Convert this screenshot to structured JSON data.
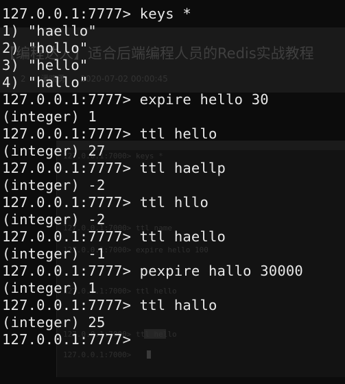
{
  "background_color": "#0c0c0c",
  "text_color": "#e8e8e8",
  "ghost": {
    "title": "【编程达人】适合后端编程人员的Redis实战教程",
    "meta": [
      "2",
      "潘晓勇",
      "2020-07-02 00:00:45"
    ],
    "lines": [
      "127.0.0.1:7000> keys *",
      "127.0.0.1:7000> ttl name",
      "127.0.0.1:7000> expire hello 100",
      "127.0.0.1:7000> ttl hello",
      "127.0.0.1:7000> ttl hello",
      "127.0.0.1:7000>"
    ]
  },
  "terminal": {
    "lines": [
      "127.0.0.1:7777> keys *",
      "1) \"haello\"",
      "2) \"hollo\"",
      "3) \"hello\"",
      "4) \"hallo\"",
      "127.0.0.1:7777> expire hello 30",
      "(integer) 1",
      "127.0.0.1:7777> ttl hello",
      "(integer) 27",
      "127.0.0.1:7777> ttl haellp",
      "(integer) -2",
      "127.0.0.1:7777> ttl hllo",
      "(integer) -2",
      "127.0.0.1:7777> ttl haello",
      "(integer) -1",
      "127.0.0.1:7777> pexpire hallo 30000",
      "(integer) 1",
      "127.0.0.1:7777> ttl hallo",
      "(integer) 25",
      "127.0.0.1:7777>"
    ]
  }
}
